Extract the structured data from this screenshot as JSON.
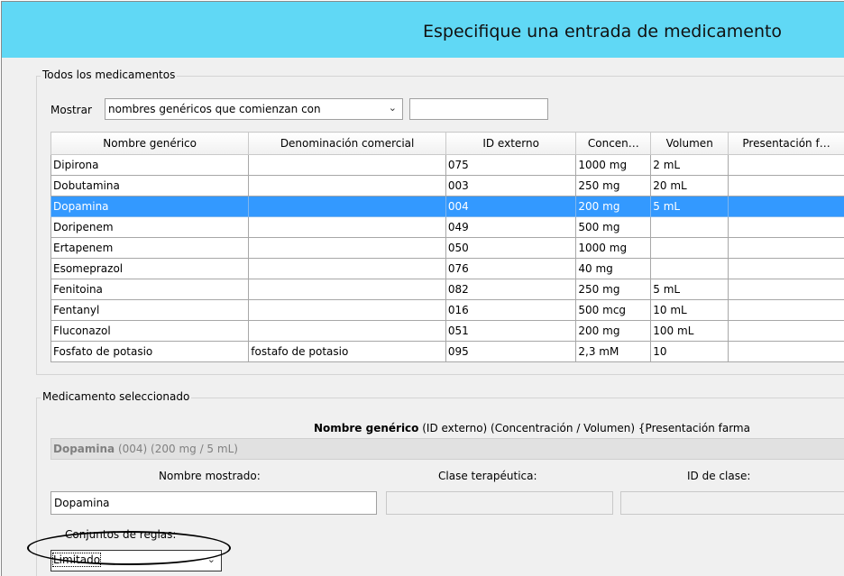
{
  "window": {
    "title": "Especifique una entrada de medicamento"
  },
  "all_meds": {
    "legend": "Todos los medicamentos",
    "show_label": "Mostrar",
    "filter_select": "nombres genéricos que comienzan con",
    "filter_text": "",
    "columns": [
      "Nombre genérico",
      "Denominación comercial",
      "ID externo",
      "Concen…",
      "Volumen",
      "Presentación f…"
    ],
    "rows": [
      [
        "Dipirona",
        "",
        "075",
        "1000 mg",
        "2 mL",
        ""
      ],
      [
        "Dobutamina",
        "",
        "003",
        "250 mg",
        "20 mL",
        ""
      ],
      [
        "Dopamina",
        "",
        "004",
        "200 mg",
        "5 mL",
        ""
      ],
      [
        "Doripenem",
        "",
        "049",
        "500 mg",
        "",
        ""
      ],
      [
        "Ertapenem",
        "",
        "050",
        "1000 mg",
        "",
        ""
      ],
      [
        "Esomeprazol",
        "",
        "076",
        "40 mg",
        "",
        ""
      ],
      [
        "Fenitoina",
        "",
        "082",
        "250 mg",
        "5 mL",
        ""
      ],
      [
        "Fentanyl",
        "",
        "016",
        "500 mcg",
        "10 mL",
        ""
      ],
      [
        "Fluconazol",
        "",
        "051",
        "200 mg",
        "100 mL",
        ""
      ],
      [
        "Fosfato de potasio",
        "fostafo de potasio",
        "095",
        "2,3 mM",
        "10",
        ""
      ]
    ],
    "selected_row": 2
  },
  "selected": {
    "legend": "Medicamento seleccionado",
    "format_bold": "Nombre genérico",
    "format_rest": " (ID externo) (Concentración / Volumen) {Presentación farma",
    "summary_bold": "Dopamina",
    "summary_rest": " (004) (200 mg / 5 mL)",
    "display_name_label": "Nombre mostrado:",
    "display_name_value": "Dopamina",
    "therapeutic_class_label": "Clase terapéutica:",
    "class_id_label": "ID de clase:",
    "rule_sets_label": "Conjuntos de reglas:",
    "rule_sets_value": "Limitado"
  }
}
